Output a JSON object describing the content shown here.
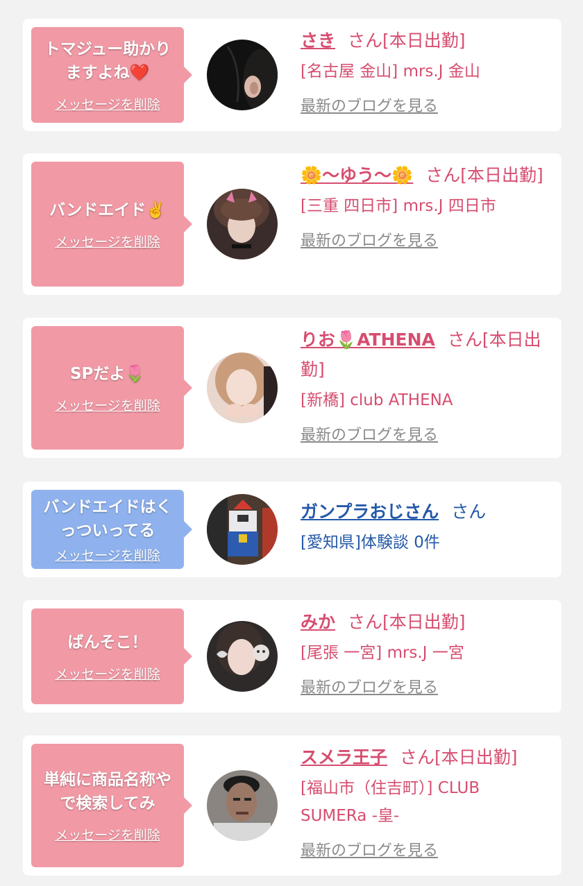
{
  "colors": {
    "page_bg": "#f2f2f2",
    "card_bg": "#ffffff",
    "bubble_pink": "#f19aa6",
    "bubble_blue": "#8fb2ee",
    "name_pink": "#d64d6f",
    "name_blue": "#2459a8",
    "blog_link": "#8a8a8a"
  },
  "delete_label": "メッセージを削除",
  "blog_label": "最新のブログを見る",
  "items": [
    {
      "message_lines": [
        "トマジュー助かり",
        "ますよね❤️"
      ],
      "name": "さき",
      "honorific": "さん[本日出勤]",
      "shop": "[名古屋 金山] mrs.J 金山",
      "theme": "pink"
    },
    {
      "message_lines": [
        "バンドエイド✌️"
      ],
      "name": "🌼〜ゆう〜🌼",
      "honorific": "さん[本日出勤]",
      "shop": "[三重 四日市] mrs.J 四日市",
      "theme": "pink"
    },
    {
      "message_lines": [
        "SPだよ🌷"
      ],
      "name": "りお🌷ATHENA",
      "honorific": "さん[本日出勤]",
      "shop": "[新橋] club ATHENA",
      "theme": "pink"
    },
    {
      "message_lines": [
        "バンドエイドはく",
        "っついってる"
      ],
      "name": "ガンプラおじさん",
      "honorific": "さん",
      "shop": "[愛知県]体験談 0件",
      "theme": "blue"
    },
    {
      "message_lines": [
        "ばんそこ！"
      ],
      "name": "みか",
      "honorific": "さん[本日出勤]",
      "shop": "[尾張 一宮] mrs.J 一宮",
      "theme": "pink"
    },
    {
      "message_lines": [
        "単純に商品名称や",
        "で検索してみ"
      ],
      "name": "スメラ王子",
      "honorific": "さん[本日出勤]",
      "shop": "[福山市（住吉町）] CLUB SUMERa -皇-",
      "theme": "pink"
    }
  ]
}
